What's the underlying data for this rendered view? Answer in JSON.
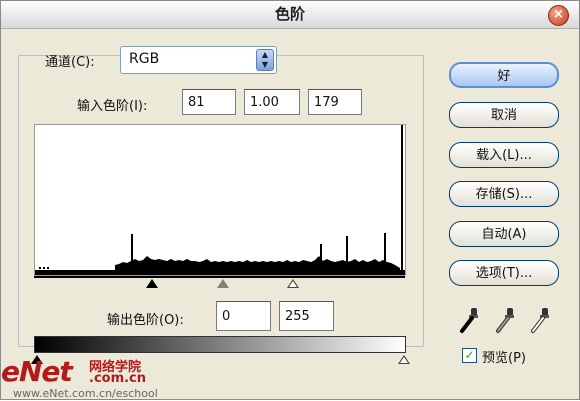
{
  "dialog": {
    "title": "色阶",
    "close_label": "×"
  },
  "channel": {
    "label": "通道(C):",
    "value": "RGB"
  },
  "input_levels": {
    "label": "输入色阶(I):",
    "black": "81",
    "gamma": "1.00",
    "white": "179"
  },
  "output_levels": {
    "label": "输出色阶(O):",
    "black": "0",
    "white": "255"
  },
  "buttons": {
    "ok": "好",
    "cancel": "取消",
    "load": "载入(L)...",
    "save": "存储(S)...",
    "auto": "自动(A)",
    "options": "选项(T)..."
  },
  "preview": {
    "label": "预览(P)",
    "checked": true
  },
  "watermark": {
    "logo": "eNet",
    "cn_text": "网络学院",
    "domain": ".com.cn",
    "url": "www.eNet.com.cn/eschool"
  },
  "icons": {
    "black_point": "black-eyedropper-icon",
    "gray_point": "gray-eyedropper-icon",
    "white_point": "white-eyedropper-icon"
  },
  "colors": {
    "accent": "#5a8fd6",
    "watermark": "#b31b1b"
  }
}
